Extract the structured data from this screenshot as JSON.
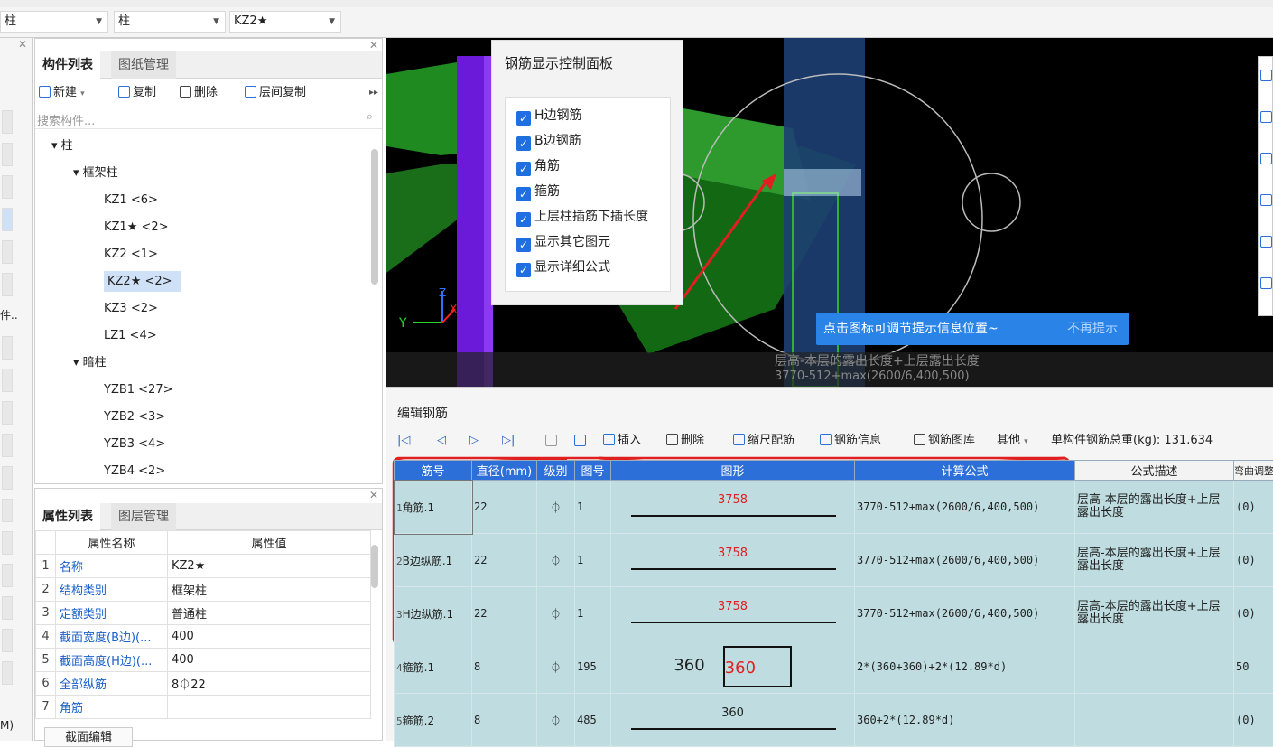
{
  "topbar": {
    "floor_label": "柱",
    "type_select": "柱",
    "component_select": "KZ2★"
  },
  "component_panel": {
    "tabs": [
      "构件列表",
      "图纸管理"
    ],
    "toolbar": {
      "new": "新建",
      "copy": "复制",
      "delete": "删除",
      "floor_copy": "层间复制"
    },
    "search_placeholder": "搜索构件...",
    "tree": {
      "root": "柱",
      "groups": [
        {
          "name": "框架柱",
          "items": [
            "KZ1 <6>",
            "KZ1★ <2>",
            "KZ2 <1>",
            "KZ2★ <2>",
            "KZ3 <2>",
            "LZ1 <4>"
          ]
        },
        {
          "name": "暗柱",
          "items": [
            "YZB1 <27>",
            "YZB2 <3>",
            "YZB3 <4>",
            "YZB4 <2>"
          ]
        }
      ],
      "selected": "KZ2★ <2>"
    }
  },
  "property_panel": {
    "tabs": [
      "属性列表",
      "图层管理"
    ],
    "headers": [
      "属性名称",
      "属性值"
    ],
    "rows": [
      {
        "no": "1",
        "name": "名称",
        "value": "KZ2★"
      },
      {
        "no": "2",
        "name": "结构类别",
        "value": "框架柱"
      },
      {
        "no": "3",
        "name": "定额类别",
        "value": "普通柱"
      },
      {
        "no": "4",
        "name": "截面宽度(B边)(...",
        "value": "400"
      },
      {
        "no": "5",
        "name": "截面高度(H边)(...",
        "value": "400"
      },
      {
        "no": "6",
        "name": "全部纵筋",
        "value": "8⏀22"
      },
      {
        "no": "7",
        "name": "角筋",
        "value": ""
      }
    ],
    "bottom_button": "截面编辑",
    "left_cut_text": "件..",
    "left_cut_text2": "M)"
  },
  "control_panel": {
    "title": "钢筋显示控制面板",
    "options": [
      "H边钢筋",
      "B边钢筋",
      "角筋",
      "箍筋",
      "上层柱插筋下插长度",
      "显示其它图元",
      "显示详细公式"
    ]
  },
  "viewport": {
    "tip": "点击图标可调节提示信息位置~",
    "tip_dismiss": "不再提示",
    "overlay_line1": "层高-本层的露出长度+上层露出长度",
    "overlay_line2": "3770-512+max(2600/6,400,500)",
    "axis_y": "Y",
    "axis_z": "Z",
    "axis_x": "X"
  },
  "editor": {
    "title": "编辑钢筋",
    "toolbar": {
      "insert": "插入",
      "delete": "删除",
      "scale": "缩尺配筋",
      "info": "钢筋信息",
      "library": "钢筋图库",
      "other": "其他",
      "total_label": "单构件钢筋总重(kg): 131.634"
    },
    "headers": [
      "筋号",
      "直径(mm)",
      "级别",
      "图号",
      "图形",
      "计算公式",
      "公式描述",
      "弯曲调整"
    ],
    "rows": [
      {
        "idx": "1",
        "name": "角筋.1",
        "dia": "22",
        "grade": "⏀",
        "fig": "1",
        "shape": "3758",
        "formula": "3770-512+max(2600/6,400,500)",
        "desc": "层高-本层的露出长度+上层露出长度",
        "adj": "(0)"
      },
      {
        "idx": "2",
        "name": "B边纵筋.1",
        "dia": "22",
        "grade": "⏀",
        "fig": "1",
        "shape": "3758",
        "formula": "3770-512+max(2600/6,400,500)",
        "desc": "层高-本层的露出长度+上层露出长度",
        "adj": "(0)"
      },
      {
        "idx": "3",
        "name": "H边纵筋.1",
        "dia": "22",
        "grade": "⏀",
        "fig": "1",
        "shape": "3758",
        "formula": "3770-512+max(2600/6,400,500)",
        "desc": "层高-本层的露出长度+上层露出长度",
        "adj": "(0)"
      },
      {
        "idx": "4",
        "name": "箍筋.1",
        "dia": "8",
        "grade": "⏀",
        "fig": "195",
        "shape_a": "360",
        "shape_b": "360",
        "formula": "2*(360+360)+2*(12.89*d)",
        "desc": "",
        "adj": "50"
      },
      {
        "idx": "5",
        "name": "箍筋.2",
        "dia": "8",
        "grade": "⏀",
        "fig": "485",
        "shape": "360",
        "formula": "360+2*(12.89*d)",
        "desc": "",
        "adj": "(0)"
      }
    ]
  },
  "colors": {
    "accent": "#2d6fd8",
    "grid_cell": "#bfdde0",
    "annotation": "#e02020"
  }
}
